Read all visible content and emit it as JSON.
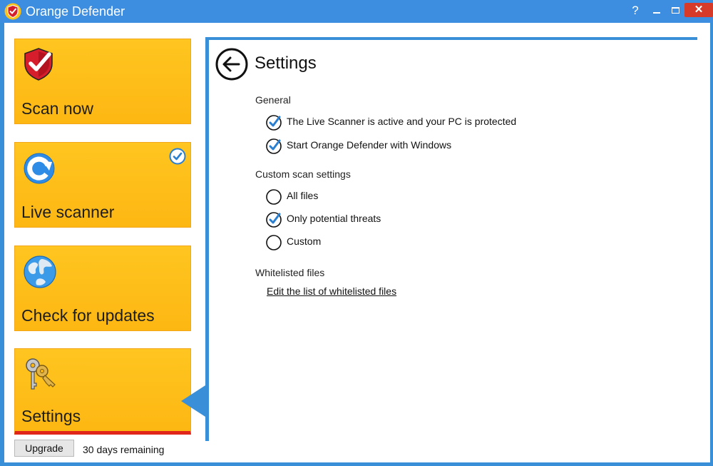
{
  "window": {
    "title": "Orange Defender",
    "help_label": "?",
    "close_label": "✕"
  },
  "sidebar": {
    "tiles": [
      {
        "label": "Scan now",
        "icon": "shield-check-icon"
      },
      {
        "label": "Live scanner",
        "icon": "refresh-icon",
        "status_icon": "check-circle-icon",
        "active": true
      },
      {
        "label": "Check for updates",
        "icon": "globe-icon"
      },
      {
        "label": "Settings",
        "icon": "keys-icon",
        "selected": true
      }
    ]
  },
  "footer": {
    "upgrade_label": "Upgrade",
    "trial_status": "30 days remaining"
  },
  "settings": {
    "title": "Settings",
    "general": {
      "heading": "General",
      "options": [
        {
          "label": "The Live Scanner is active and your PC is protected",
          "checked": true
        },
        {
          "label": "Start Orange Defender with Windows",
          "checked": true
        }
      ]
    },
    "custom_scan": {
      "heading": "Custom scan settings",
      "options": [
        {
          "label": "All files",
          "checked": false
        },
        {
          "label": "Only potential threats",
          "checked": true
        },
        {
          "label": "Custom",
          "checked": false
        }
      ]
    },
    "whitelist": {
      "heading": "Whitelisted files",
      "link_label": "Edit the list of whitelisted files"
    }
  },
  "colors": {
    "titlebar": "#3d8ee0",
    "tile": "#fdb713",
    "accent_red": "#e0261a",
    "check_blue": "#2b7fd0",
    "close_button": "#d83a2a"
  }
}
